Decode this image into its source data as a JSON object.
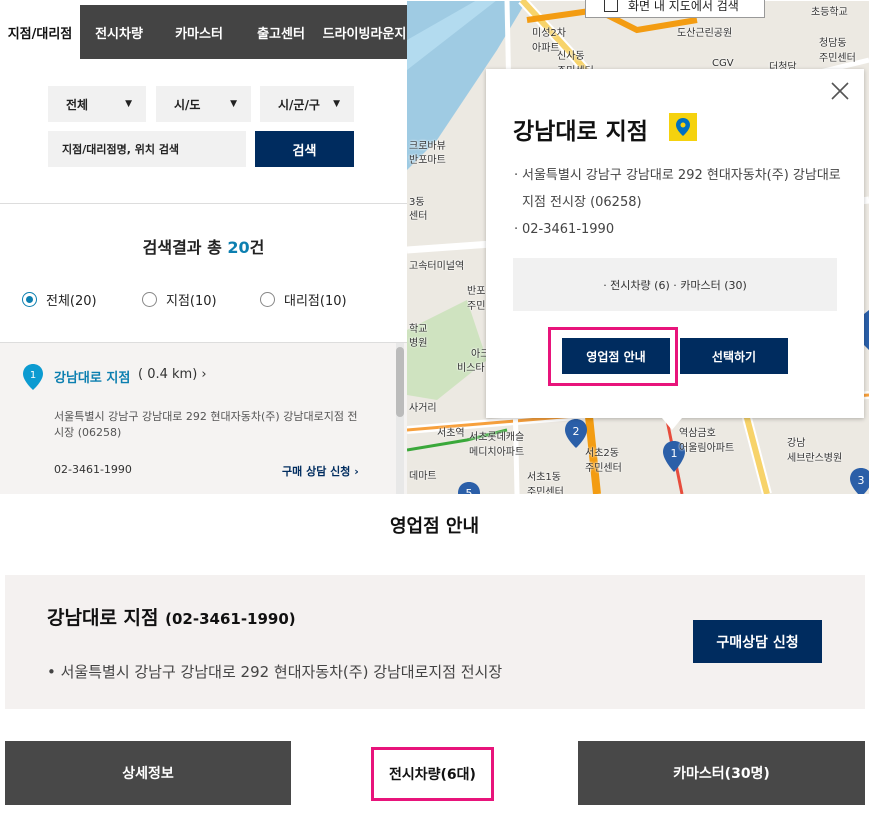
{
  "tabs": [
    "지점/대리점",
    "전시차량",
    "카마스터",
    "출고센터",
    "드라이빙라운지"
  ],
  "filters": {
    "select1": "전체",
    "select2": "시/도",
    "select3": "시/군/구",
    "search_placeholder": "지점/대리점명, 위치 검색",
    "search_button": "검색"
  },
  "results": {
    "title_prefix": "검색결과 총 ",
    "count": "20",
    "title_suffix": "건"
  },
  "radios": [
    "전체(20)",
    "지점(10)",
    "대리점(10)"
  ],
  "list_item": {
    "index": "1",
    "name": "강남대로 지점",
    "distance": "( 0.4 km)",
    "address": "서울특별시 강남구 강남대로 292 현대자동차(주) 강남대로지점 전시장 (06258)",
    "phone": "02-3461-1990",
    "link": "구매 상담 신청"
  },
  "map": {
    "checkbox_label": "화면 내 지도에서 검색",
    "labels": [
      "미성2차\n아파트",
      "신사동\n주민센터",
      "도산근린공원",
      "CGV",
      "더청담",
      "청담동\n주민센터",
      "초등학교",
      "크로바뷰",
      "반포마트",
      "고속터미널역",
      "반포\n주민",
      "강",
      "학교",
      "병원",
      "아크",
      "비스타",
      "사거리",
      "서초롯데캐슬\n메디치아파트",
      "서초2동\n주민센터",
      "서초1동\n주민센터",
      "서초역",
      "데마트",
      "역삼금호\n어울림아파트",
      "강남\n세브란스병원",
      "서초2동",
      "3동",
      "센터"
    ],
    "markers": [
      "1",
      "2",
      "3",
      "5"
    ]
  },
  "popup": {
    "title": "강남대로 지점",
    "address_line1": "서울특별시 강남구 강남대로 292 현대자동차(주) 강남대로 지점 전시장 (06258)",
    "phone": "02-3461-1990",
    "info": "· 전시차량 (6)  · 카마스터 (30)",
    "button_info": "영업점 안내",
    "button_select": "선택하기"
  },
  "bottom": {
    "title": "영업점 안내",
    "store_name": "강남대로 지점",
    "store_phone": "(02-3461-1990)",
    "store_address": "•  서울특별시 강남구 강남대로 292 현대자동차(주) 강남대로지점 전시장",
    "buy_button": "구매상담 신청",
    "tabs": [
      "상세정보",
      "전시차량(6대)",
      "카마스터(30명)"
    ]
  },
  "colors": {
    "navy": "#002c5f",
    "accent_blue": "#0c7fb0",
    "highlight_pink": "#e8147b",
    "dark_gray": "#484848",
    "pin_yellow": "#f5d20e"
  }
}
